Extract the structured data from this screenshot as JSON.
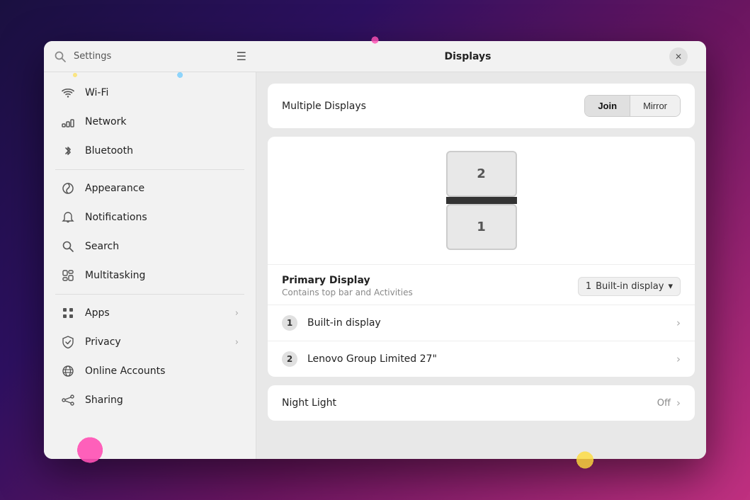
{
  "window": {
    "title": "Displays",
    "settings_label": "Settings"
  },
  "sidebar": {
    "items": [
      {
        "id": "wifi",
        "label": "Wi-Fi",
        "icon": "wifi",
        "arrow": false
      },
      {
        "id": "network",
        "label": "Network",
        "icon": "network",
        "arrow": false
      },
      {
        "id": "bluetooth",
        "label": "Bluetooth",
        "icon": "bluetooth",
        "arrow": false
      },
      {
        "id": "appearance",
        "label": "Appearance",
        "icon": "appearance",
        "arrow": false
      },
      {
        "id": "notifications",
        "label": "Notifications",
        "icon": "notifications",
        "arrow": false
      },
      {
        "id": "search",
        "label": "Search",
        "icon": "search",
        "arrow": false
      },
      {
        "id": "multitasking",
        "label": "Multitasking",
        "icon": "multitasking",
        "arrow": false
      },
      {
        "id": "apps",
        "label": "Apps",
        "icon": "apps",
        "arrow": true
      },
      {
        "id": "privacy",
        "label": "Privacy",
        "icon": "privacy",
        "arrow": true
      },
      {
        "id": "online-accounts",
        "label": "Online Accounts",
        "icon": "online-accounts",
        "arrow": false
      },
      {
        "id": "sharing",
        "label": "Sharing",
        "icon": "sharing",
        "arrow": false
      }
    ]
  },
  "main": {
    "multiple_displays": {
      "label": "Multiple Displays",
      "join_label": "Join",
      "mirror_label": "Mirror",
      "active_btn": "join"
    },
    "display_diagram": {
      "display2_num": "2",
      "display1_num": "1"
    },
    "primary_display": {
      "title": "Primary Display",
      "subtitle": "Contains top bar and Activities",
      "select_num": "1",
      "select_label": "Built-in display"
    },
    "display_list": [
      {
        "num": "1",
        "name": "Built-in display"
      },
      {
        "num": "2",
        "name": "Lenovo Group Limited 27\""
      }
    ],
    "night_light": {
      "label": "Night Light",
      "status": "Off"
    }
  },
  "colors": {
    "active_btn_bg": "#e0e0e0"
  }
}
